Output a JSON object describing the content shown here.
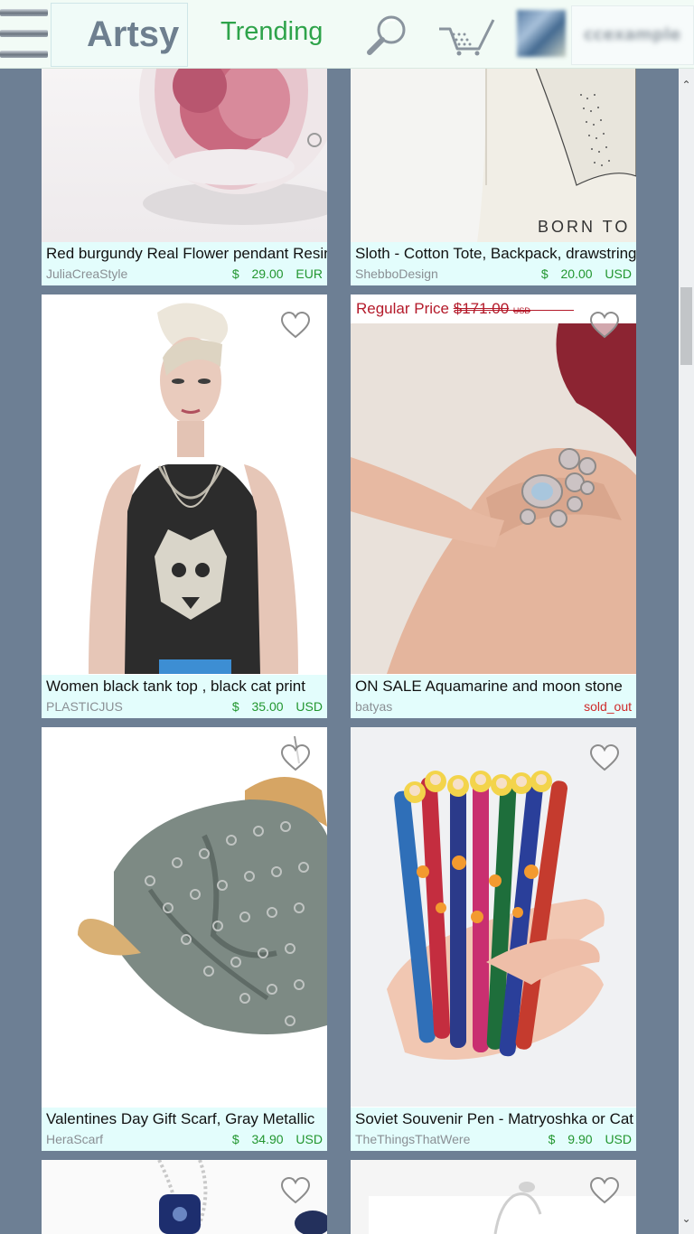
{
  "header": {
    "brand": "Artsy",
    "nav_trending": "Trending",
    "username": "ccexample"
  },
  "products": [
    {
      "title": "Red burgundy Real Flower pendant Resin",
      "seller": "JuliaCreaStyle",
      "price": "$ 29.00 EUR"
    },
    {
      "title": "Sloth - Cotton Tote, Backpack, drawstring",
      "seller": "ShebboDesign",
      "price": "$ 20.00 USD",
      "image_text": "BORN TO B"
    },
    {
      "title": "Women black tank top , black cat print",
      "seller": "PLASTICJUS",
      "price": "$ 35.00 USD"
    },
    {
      "title": "ON SALE Aquamarine and moon stone",
      "seller": "batyas",
      "status": "sold_out",
      "regular_price_label": "Regular Price",
      "regular_price_value": "$171.00",
      "regular_price_currency": "USD"
    },
    {
      "title": "Valentines Day Gift Scarf, Gray Metallic",
      "seller": "HeraScarf",
      "price": "$ 34.90 USD"
    },
    {
      "title": "Soviet Souvenir Pen - Matryoshka or Cat",
      "seller": "TheThingsThatWere",
      "price": "$ 9.90 USD"
    }
  ],
  "colors": {
    "background": "#6d7f94",
    "caption_bg": "#e3fdfc",
    "price_green": "#22962f",
    "sold_out_red": "#cf2a2a",
    "trending_green": "#2ea34a"
  },
  "icons": [
    "menu-icon",
    "search-icon",
    "cart-icon",
    "heart-icon",
    "scroll-up-icon",
    "scroll-down-icon"
  ]
}
